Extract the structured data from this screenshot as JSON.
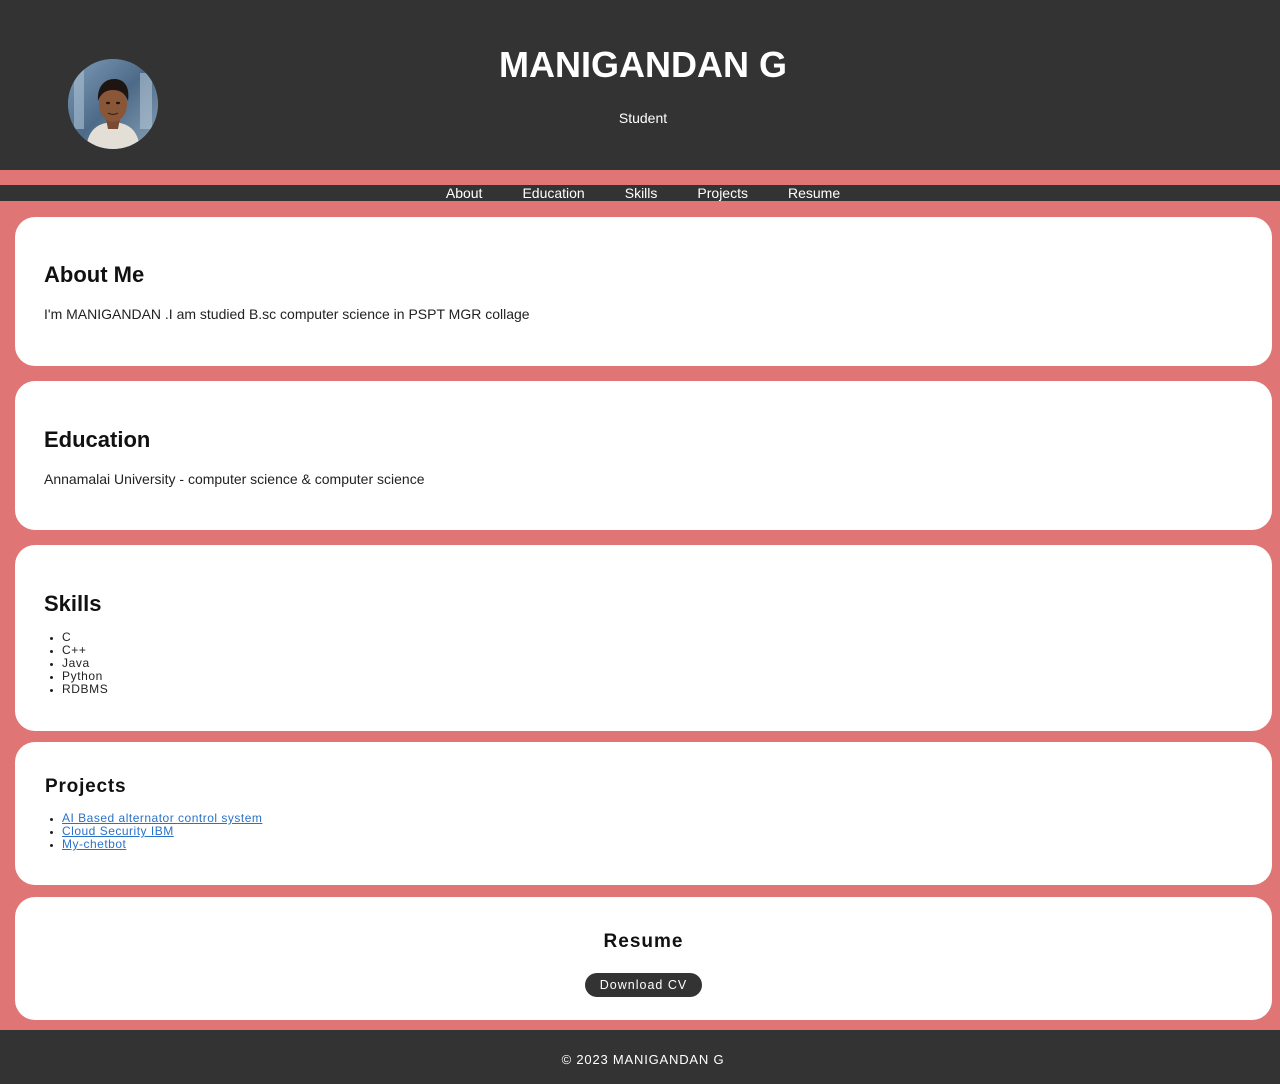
{
  "header": {
    "name": "MANIGANDAN G",
    "subtitle": "Student"
  },
  "nav": {
    "items": [
      {
        "label": "About"
      },
      {
        "label": "Education"
      },
      {
        "label": "Skills"
      },
      {
        "label": "Projects"
      },
      {
        "label": "Resume"
      }
    ]
  },
  "about": {
    "title": "About Me",
    "text": "I'm MANIGANDAN .I am studied B.sc computer science in PSPT MGR collage"
  },
  "education": {
    "title": "Education",
    "text": "Annamalai University - computer science & computer science"
  },
  "skills": {
    "title": "Skills",
    "items": [
      "C",
      "C++",
      "Java",
      "Python",
      "RDBMS"
    ]
  },
  "projects": {
    "title": "Projects",
    "items": [
      "AI Based alternator control system",
      "Cloud Security IBM",
      "My-chetbot"
    ]
  },
  "resume": {
    "title": "Resume",
    "button_label": "Download CV"
  },
  "footer": {
    "text": "© 2023 MANIGANDAN G"
  },
  "colors": {
    "page_bg": "#e07575",
    "dark_bg": "#333333",
    "card_bg": "#ffffff",
    "link": "#2a72c9"
  }
}
